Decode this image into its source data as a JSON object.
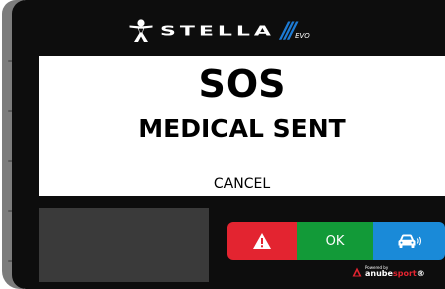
{
  "header": {
    "brand_name": "STELLA",
    "brand_slashes": "///",
    "brand_model": "EVO"
  },
  "screen": {
    "title": "SOS",
    "subtitle": "MEDICAL SENT",
    "cancel_label": "CANCEL"
  },
  "actions": {
    "alert_icon": "warning-triangle-icon",
    "ok_label": "OK",
    "car_icon": "car-signal-icon"
  },
  "footer": {
    "powered_by": "Powered by",
    "brand_main": "anube",
    "brand_accent": "sport",
    "brand_suffix": "®"
  },
  "colors": {
    "frame": "#0d0d0d",
    "bezel": "#7c7c7c",
    "alert": "#e32430",
    "ok": "#129a38",
    "car": "#1a8ad8",
    "brand_accent": "#1d7bd4",
    "grey_panel": "#3a3a3a"
  }
}
